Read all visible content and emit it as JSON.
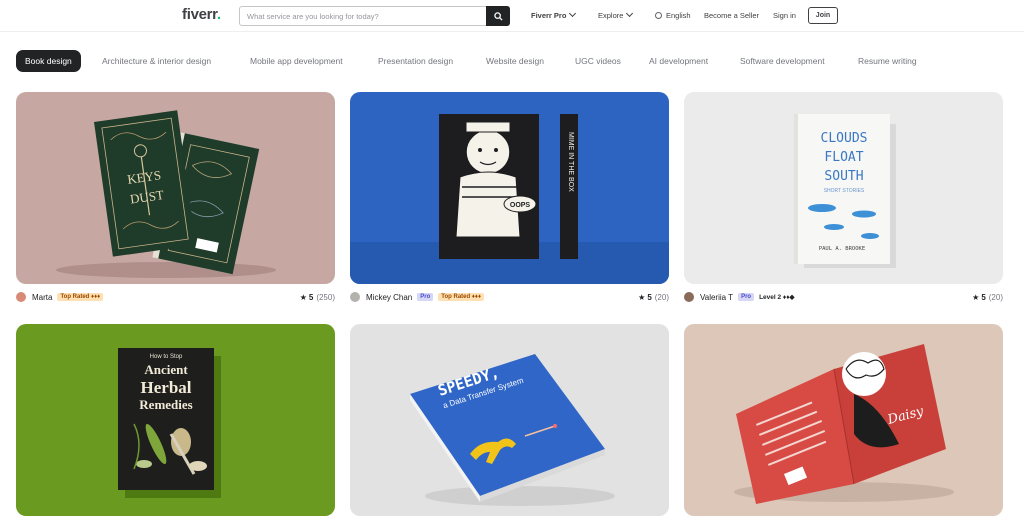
{
  "header": {
    "logo_text": "fiverr",
    "logo_dot": ".",
    "search_placeholder": "What service are you looking for today?",
    "nav": {
      "fiverr_pro": "Fiverr Pro",
      "explore": "Explore",
      "language": "English",
      "become_seller": "Become a Seller",
      "sign_in": "Sign in",
      "join": "Join"
    }
  },
  "categories": [
    "Book design",
    "Architecture & interior design",
    "Mobile app development",
    "Presentation design",
    "Website design",
    "UGC videos",
    "AI development",
    "Software development",
    "Resume writing"
  ],
  "active_category": "Book design",
  "colors": {
    "brand_green": "#1dbf73",
    "dark": "#222325",
    "pro_badge_bg": "#d6d6f5",
    "top_rated_bg": "#ffe0b2"
  },
  "cards": [
    {
      "seller": "Marta",
      "level": "Top Rated ♦♦♦",
      "rating": "5",
      "reviews": "(250)",
      "cover_title_1": "KEYS",
      "cover_title_2": "DUST"
    },
    {
      "seller": "Mickey Chan",
      "pro": "Pro",
      "level": "Top Rated ♦♦♦",
      "rating": "5",
      "reviews": "(20)",
      "cover_badge": "OOPS",
      "spine_text": "MIME IN THE BOX"
    },
    {
      "seller": "Valeriia T",
      "pro": "Pro",
      "level": "Level 2 ♦♦◆",
      "rating": "5",
      "reviews": "(20)",
      "cover_title_1": "CLOUDS",
      "cover_title_2": "FLOAT",
      "cover_title_3": "SOUTH",
      "cover_sub": "SHORT STORIES",
      "cover_author": "PAUL A. BROOKE"
    },
    {
      "cover_title_1": "How to Stop",
      "cover_title_2": "Ancient",
      "cover_title_3": "Herbal",
      "cover_title_4": "Remedies"
    },
    {
      "cover_title_1": "SPEEDY,",
      "cover_title_2": "a Data Transfer System"
    },
    {
      "cover_title_1": "Daisy"
    }
  ]
}
